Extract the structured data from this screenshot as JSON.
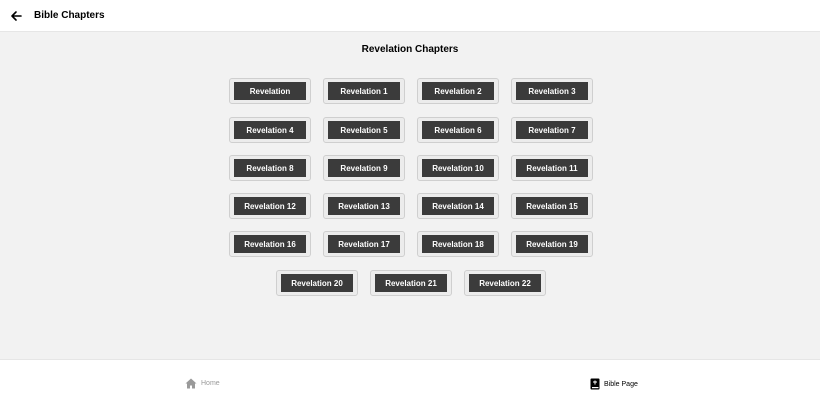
{
  "header": {
    "title": "Bible Chapters",
    "back_icon": "arrow-left-icon"
  },
  "main": {
    "heading": "Revelation Chapters",
    "chapters": [
      "Revelation",
      "Revelation 1",
      "Revelation 2",
      "Revelation 3",
      "Revelation 4",
      "Revelation 5",
      "Revelation 6",
      "Revelation 7",
      "Revelation 8",
      "Revelation 9",
      "Revelation 10",
      "Revelation 11",
      "Revelation 12",
      "Revelation 13",
      "Revelation 14",
      "Revelation 15",
      "Revelation 16",
      "Revelation 17",
      "Revelation 18",
      "Revelation 19",
      "Revelation 20",
      "Revelation 21",
      "Revelation 22"
    ]
  },
  "bottom_nav": {
    "home": {
      "label": "Home",
      "icon": "home-icon"
    },
    "bible": {
      "label": "Bible Page",
      "icon": "book-icon"
    }
  },
  "colors": {
    "button_bg": "#3b3b3b",
    "button_text": "#ffffff",
    "page_bg": "#f2f2f2",
    "inactive_nav": "#9a9a9a"
  }
}
